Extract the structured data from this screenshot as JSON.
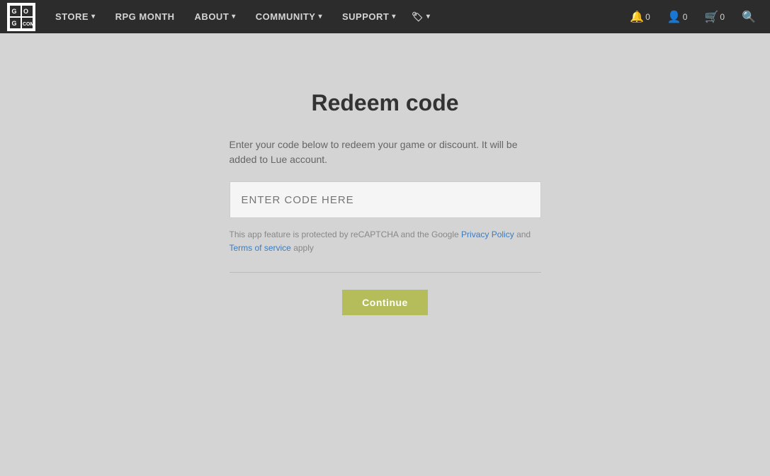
{
  "navbar": {
    "logo_text": "GOG\nCOM",
    "links": [
      {
        "label": "STORE",
        "has_dropdown": true
      },
      {
        "label": "RPG MONTH",
        "has_dropdown": false
      },
      {
        "label": "ABOUT",
        "has_dropdown": true
      },
      {
        "label": "COMMUNITY",
        "has_dropdown": true
      },
      {
        "label": "SUPPORT",
        "has_dropdown": true
      }
    ],
    "icons": [
      {
        "name": "notifications",
        "symbol": "🔔",
        "count": "0"
      },
      {
        "name": "user",
        "symbol": "👤",
        "count": "0"
      },
      {
        "name": "cart",
        "symbol": "🛒",
        "count": "0"
      },
      {
        "name": "search",
        "symbol": "🔍",
        "count": ""
      }
    ],
    "extra_icon": "🏷"
  },
  "page": {
    "title": "Redeem code",
    "description_line1": "Enter your code below to redeem your game or discount. It will be",
    "description_line2": "added to Lue account.",
    "code_placeholder": "ENTER CODE HERE",
    "recaptcha_text_before": "This app feature is protected by reCAPTCHA and the Google",
    "recaptcha_link1": "Privacy Policy",
    "recaptcha_text_between": "and",
    "recaptcha_link2": "Terms of service",
    "recaptcha_text_after": "apply",
    "continue_button": "Continue"
  }
}
